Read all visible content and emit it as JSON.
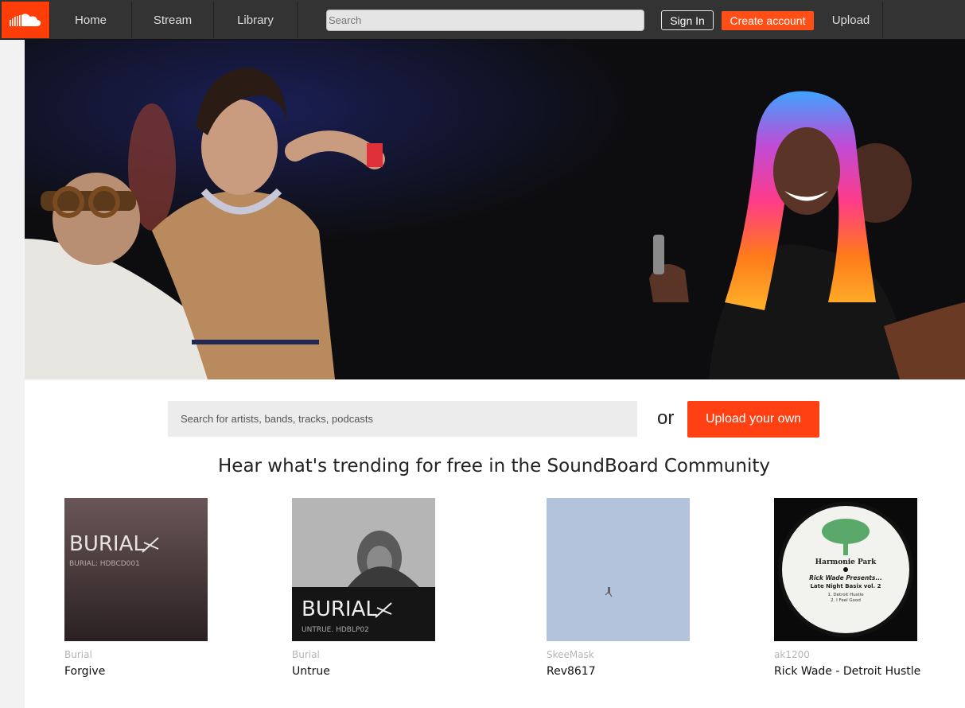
{
  "brand": {
    "accent": "#ff5500",
    "topbar_bg": "#333333"
  },
  "nav": {
    "home": "Home",
    "stream": "Stream",
    "library": "Library",
    "search_placeholder": "Search",
    "sign_in": "Sign In",
    "create_account": "Create account",
    "upload": "Upload"
  },
  "hero": {
    "image": "people-dancing-at-concert-photo"
  },
  "main": {
    "search_placeholder": "Search for artists, bands, tracks, podcasts",
    "or": "or",
    "upload_own": "Upload your own",
    "headline": "Hear what's trending for free in the SoundBoard Community"
  },
  "tracks": [
    {
      "artist": "Burial",
      "title": "Forgive",
      "art_text": "BURIAL",
      "art_sub": "BURIAL: HDBCD001"
    },
    {
      "artist": "Burial",
      "title": "Untrue",
      "art_text": "BURIAL",
      "art_sub": "UNTRUE. HDBLP02"
    },
    {
      "artist": "SkeeMask",
      "title": "Rev8617"
    },
    {
      "artist": "ak1200",
      "title": "Rick Wade - Detroit Hustle",
      "art_label_top": "Harmonie Park",
      "art_label_main": "Rick Wade Presents...",
      "art_label_sub": "Late Night Basix vol. 2",
      "art_tracks": [
        "1. Detroit Hustle",
        "2. I Feel Good"
      ]
    }
  ]
}
